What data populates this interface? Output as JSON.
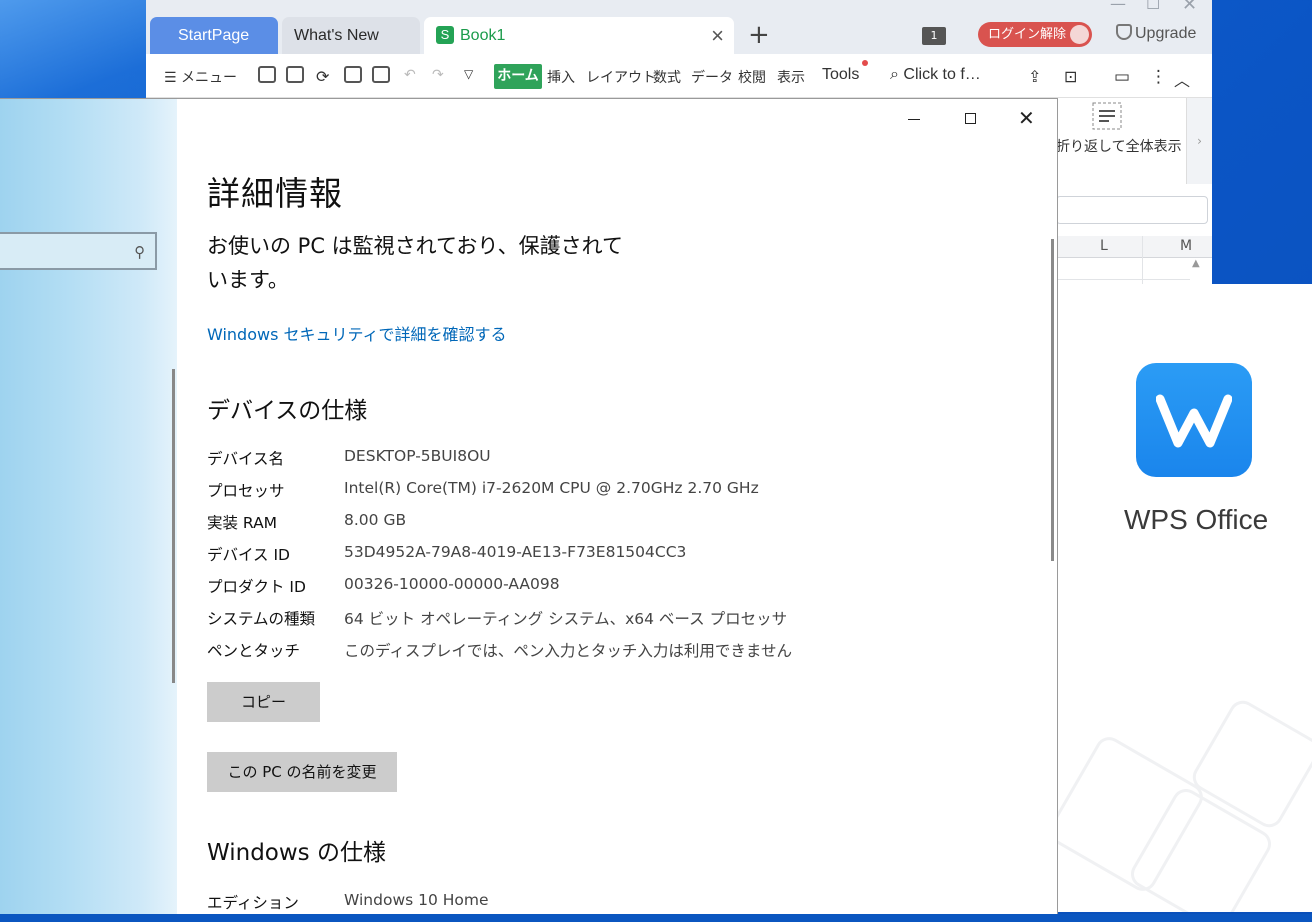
{
  "wps": {
    "tabs": [
      {
        "label": "StartPage"
      },
      {
        "label": "What's New"
      },
      {
        "label": "Book1"
      }
    ],
    "tab_count": "1",
    "login_button": "ログイン解除",
    "upgrade": "Upgrade",
    "toolbar": {
      "menu": "メニュー",
      "items": [
        "ホーム",
        "挿入",
        "レイアウト",
        "数式",
        "データ",
        "校閲",
        "表示",
        "Tools"
      ],
      "search": "Click to f…"
    },
    "ribbon_label": "折り返して全体表示",
    "columns": [
      "L",
      "M"
    ]
  },
  "splash": {
    "title": "WPS Office",
    "brand_color": "#1a85ec"
  },
  "settings": {
    "page_title": "詳細情報",
    "protect_msg": "お使いの PC は監視されており、保護されています。",
    "security_link": "Windows セキュリティで詳細を確認する",
    "device_heading": "デバイスの仕様",
    "device_specs": [
      {
        "key": "デバイス名",
        "value": "DESKTOP-5BUI8OU"
      },
      {
        "key": "プロセッサ",
        "value": "Intel(R) Core(TM) i7-2620M CPU @ 2.70GHz   2.70 GHz"
      },
      {
        "key": "実装 RAM",
        "value": "8.00 GB"
      },
      {
        "key": "デバイス ID",
        "value": "53D4952A-79A8-4019-AE13-F73E81504CC3"
      },
      {
        "key": "プロダクト ID",
        "value": "00326-10000-00000-AA098"
      },
      {
        "key": "システムの種類",
        "value": "64 ビット オペレーティング システム、x64 ベース プロセッサ"
      },
      {
        "key": "ペンとタッチ",
        "value": "このディスプレイでは、ペン入力とタッチ入力は利用できません"
      }
    ],
    "copy_button": "コピー",
    "rename_button": "この PC の名前を変更",
    "windows_heading": "Windows の仕様",
    "windows_specs": [
      {
        "key": "エディション",
        "value": "Windows 10 Home"
      }
    ],
    "link_color": "#0067b8"
  }
}
